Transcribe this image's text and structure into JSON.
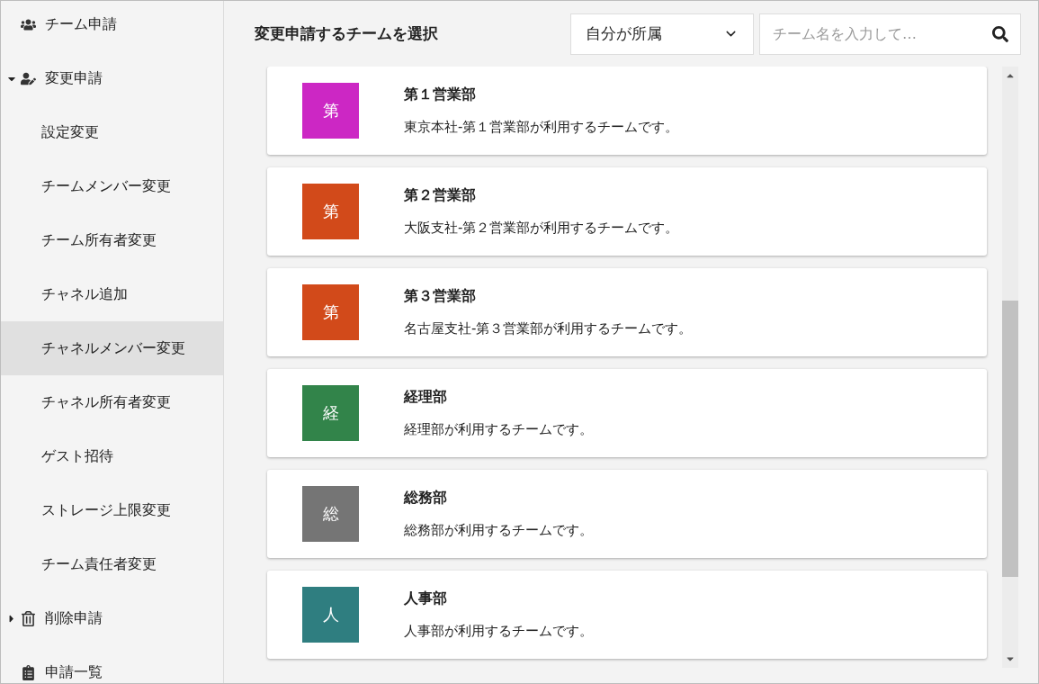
{
  "sidebar": {
    "items": [
      {
        "label": "チーム申請"
      },
      {
        "label": "変更申請",
        "expanded": true,
        "children": [
          {
            "label": "設定変更",
            "selected": false
          },
          {
            "label": "チームメンバー変更",
            "selected": false
          },
          {
            "label": "チーム所有者変更",
            "selected": false
          },
          {
            "label": "チャネル追加",
            "selected": false
          },
          {
            "label": "チャネルメンバー変更",
            "selected": true
          },
          {
            "label": "チャネル所有者変更",
            "selected": false
          },
          {
            "label": "ゲスト招待",
            "selected": false
          },
          {
            "label": "ストレージ上限変更",
            "selected": false
          },
          {
            "label": "チーム責任者変更",
            "selected": false
          }
        ]
      },
      {
        "label": "削除申請",
        "expanded": false
      },
      {
        "label": "申請一覧"
      }
    ]
  },
  "header": {
    "title": "変更申請するチームを選択",
    "filter": {
      "value": "自分が所属"
    },
    "search": {
      "placeholder": "チーム名を入力して…"
    }
  },
  "teams": [
    {
      "initial": "第",
      "color": "#cc27c4",
      "name": "第１営業部",
      "description": "東京本社-第１営業部が利用するチームです。"
    },
    {
      "initial": "第",
      "color": "#d24a1a",
      "name": "第２営業部",
      "description": "大阪支社-第２営業部が利用するチームです。"
    },
    {
      "initial": "第",
      "color": "#d24a1a",
      "name": "第３営業部",
      "description": "名古屋支社-第３営業部が利用するチームです。"
    },
    {
      "initial": "経",
      "color": "#32844a",
      "name": "経理部",
      "description": "経理部が利用するチームです。"
    },
    {
      "initial": "総",
      "color": "#757575",
      "name": "総務部",
      "description": "総務部が利用するチームです。"
    },
    {
      "initial": "人",
      "color": "#2f7e80",
      "name": "人事部",
      "description": "人事部が利用するチームです。"
    }
  ]
}
